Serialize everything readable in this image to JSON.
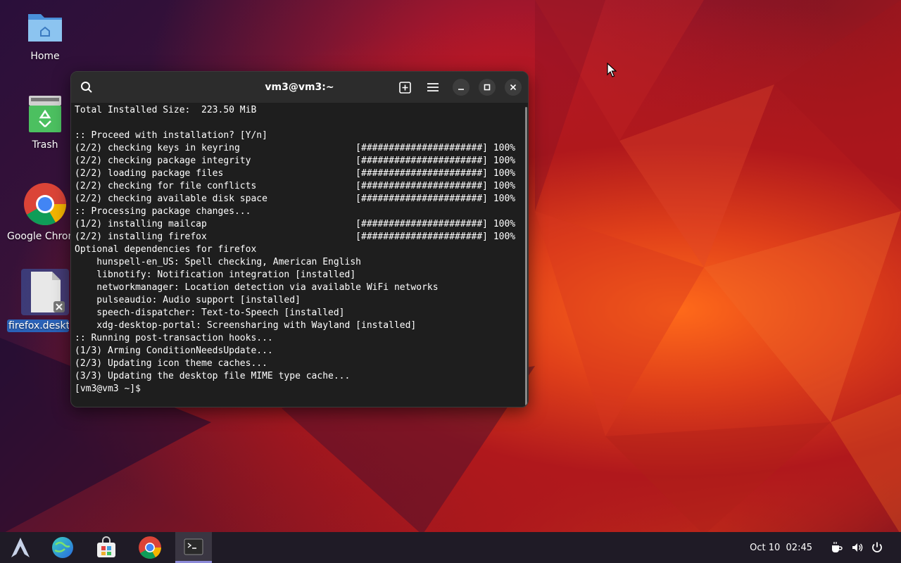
{
  "desktop": {
    "icons": [
      {
        "label": "Home"
      },
      {
        "label": "Trash"
      },
      {
        "label": "Google Chrome"
      },
      {
        "label": "firefox.desktop"
      }
    ]
  },
  "terminal": {
    "title": "vm3@vm3:~",
    "lines": [
      "Total Installed Size:  223.50 MiB",
      "",
      ":: Proceed with installation? [Y/n]",
      "(2/2) checking keys in keyring                     [######################] 100%",
      "(2/2) checking package integrity                   [######################] 100%",
      "(2/2) loading package files                        [######################] 100%",
      "(2/2) checking for file conflicts                  [######################] 100%",
      "(2/2) checking available disk space                [######################] 100%",
      ":: Processing package changes...",
      "(1/2) installing mailcap                           [######################] 100%",
      "(2/2) installing firefox                           [######################] 100%",
      "Optional dependencies for firefox",
      "    hunspell-en_US: Spell checking, American English",
      "    libnotify: Notification integration [installed]",
      "    networkmanager: Location detection via available WiFi networks",
      "    pulseaudio: Audio support [installed]",
      "    speech-dispatcher: Text-to-Speech [installed]",
      "    xdg-desktop-portal: Screensharing with Wayland [installed]",
      ":: Running post-transaction hooks...",
      "(1/3) Arming ConditionNeedsUpdate...",
      "(2/3) Updating icon theme caches...",
      "(3/3) Updating the desktop file MIME type cache...",
      "[vm3@vm3 ~]$ "
    ]
  },
  "taskbar": {
    "date": "Oct 10",
    "time": "02:45",
    "apps": [
      "arch-menu-icon",
      "browser-globe-icon",
      "software-store-icon",
      "chrome-icon",
      "terminal-icon"
    ]
  },
  "colors": {
    "accent": "#8c8ad8",
    "terminal_bg": "#1e1e1e",
    "titlebar": "#2c2c2c"
  }
}
